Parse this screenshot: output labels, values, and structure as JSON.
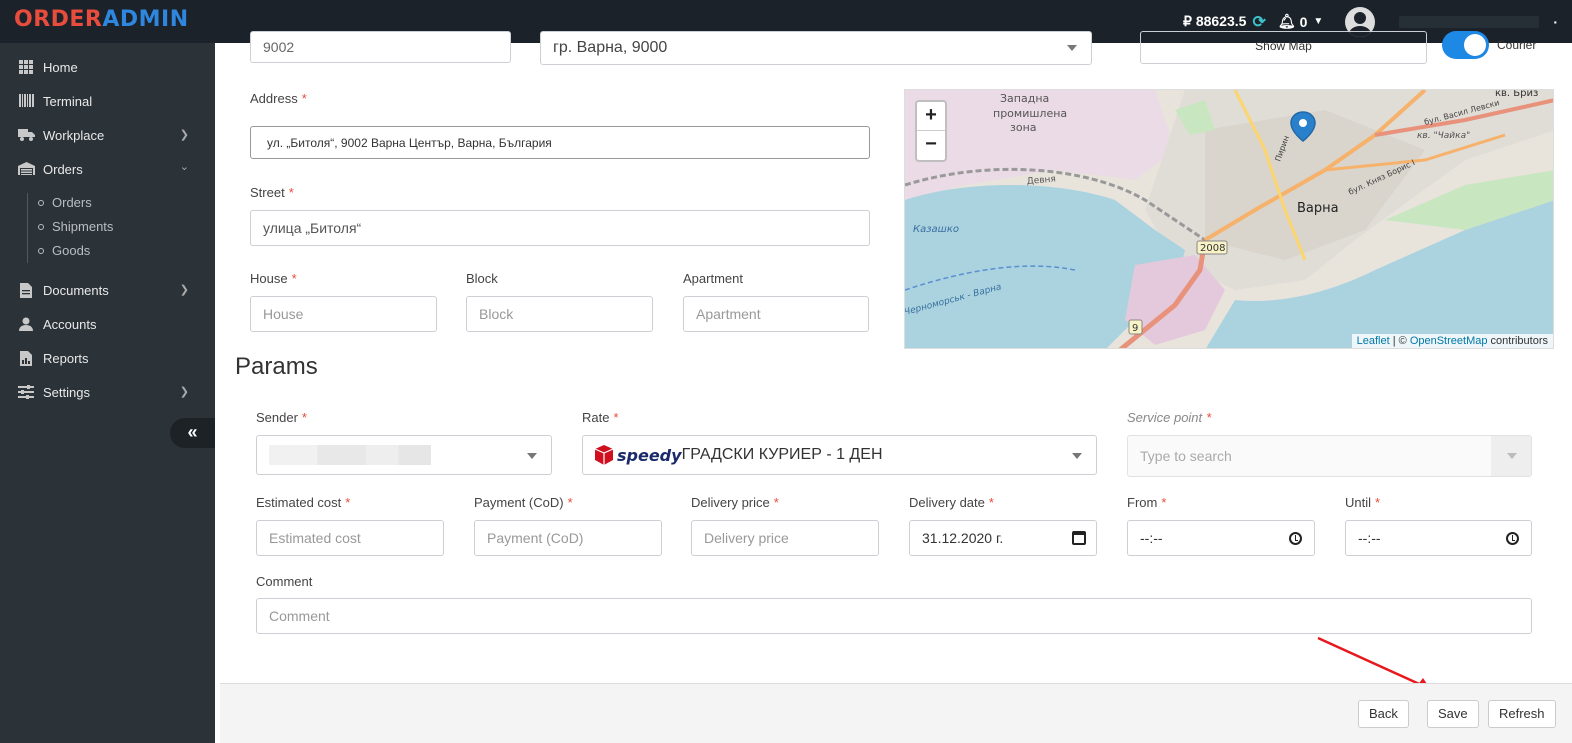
{
  "brand": {
    "part1": "ORDER",
    "part2": "ADMIN"
  },
  "topbar": {
    "balance": "₽ 88623.5",
    "notifications": "0",
    "user_dot": "·"
  },
  "sidebar": {
    "items": [
      {
        "label": "Home",
        "icon": "grid-icon"
      },
      {
        "label": "Terminal",
        "icon": "barcode-icon"
      },
      {
        "label": "Workplace",
        "icon": "truck-icon"
      },
      {
        "label": "Orders",
        "icon": "warehouse-icon"
      },
      {
        "label": "Documents",
        "icon": "file-icon"
      },
      {
        "label": "Accounts",
        "icon": "user-icon"
      },
      {
        "label": "Reports",
        "icon": "report-icon"
      },
      {
        "label": "Settings",
        "icon": "sliders-icon"
      }
    ],
    "orders_sub": [
      "Orders",
      "Shipments",
      "Goods"
    ]
  },
  "address_section": {
    "postcode_value": "9002",
    "city_value": "гр. Варна, 9000",
    "show_map_label": "Show Map",
    "courier_label": "Courier",
    "address_label": "Address",
    "address_value": "ул. „Битоля“, 9002 Варна Център, Варна, България",
    "street_label": "Street",
    "street_value": "улица „Битоля“",
    "house_label": "House",
    "house_placeholder": "House",
    "block_label": "Block",
    "block_placeholder": "Block",
    "apartment_label": "Apartment",
    "apartment_placeholder": "Apartment"
  },
  "map": {
    "zoom_in": "+",
    "zoom_out": "−",
    "labels": {
      "city": "Варна",
      "zone1": "Западна",
      "zone2": "промишлена",
      "zone3": "зона",
      "kazashko": "Казашко",
      "road2008": "2008",
      "road9": "9",
      "devnya": "Девня",
      "breez": "кв. Бриз",
      "chayka": "кв. \"Чайка\"",
      "bul1": "бул. Васил Левски",
      "bul2": "бул. Княз Борис I",
      "sea": "Черноморськ - Варна",
      "piri": "Пирин"
    },
    "attribution_leaflet": "Leaflet",
    "attribution_sep": " | © ",
    "attribution_osm": "OpenStreetMap",
    "attribution_tail": " contributors"
  },
  "params": {
    "title": "Params",
    "sender_label": "Sender",
    "rate_label": "Rate",
    "rate_logo": "speedy",
    "rate_value": "ГРАДСКИ КУРИЕР - 1 ДЕН",
    "service_point_label": "Service point",
    "service_point_placeholder": "Type to search",
    "estimated_cost_label": "Estimated cost",
    "estimated_cost_placeholder": "Estimated cost",
    "payment_label": "Payment (CoD)",
    "payment_placeholder": "Payment (CoD)",
    "delivery_price_label": "Delivery price",
    "delivery_price_placeholder": "Delivery price",
    "delivery_date_label": "Delivery date",
    "delivery_date_value": "31.12.2020 г.",
    "from_label": "From",
    "from_value": "--:--",
    "until_label": "Until",
    "until_value": "--:--",
    "comment_label": "Comment",
    "comment_placeholder": "Comment"
  },
  "footer": {
    "back": "Back",
    "save": "Save",
    "refresh": "Refresh"
  },
  "required_mark": "*",
  "colors": {
    "sidebar": "#2b3238",
    "topbar": "#1b2229",
    "accent_red": "#e74c3c",
    "accent_blue": "#2e86de",
    "toggle": "#1e88e5"
  }
}
